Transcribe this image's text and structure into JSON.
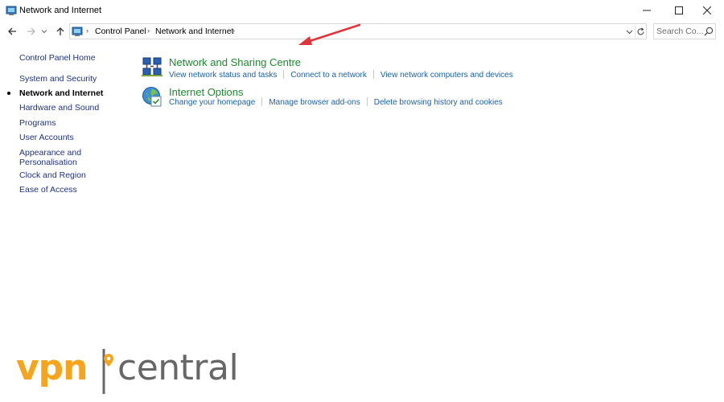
{
  "window": {
    "title": "Network and Internet",
    "icon": "control-panel-icon",
    "controls": {
      "minimize": "minimize-icon",
      "maximize": "maximize-icon",
      "close": "close-icon"
    }
  },
  "navigation": {
    "back_icon": "arrow-left-icon",
    "forward_icon": "arrow-right-icon",
    "recent_icon": "chevron-down-icon",
    "up_icon": "arrow-up-icon",
    "breadcrumb": [
      "Control Panel",
      "Network and Internet"
    ],
    "refresh_icon": "refresh-icon",
    "search": {
      "placeholder": "Search Co...",
      "value": ""
    }
  },
  "sidebar": {
    "items": [
      {
        "label": "Control Panel Home",
        "current": false
      },
      {
        "label": "System and Security",
        "current": false
      },
      {
        "label": "Network and Internet",
        "current": true
      },
      {
        "label": "Hardware and Sound",
        "current": false
      },
      {
        "label": "Programs",
        "current": false
      },
      {
        "label": "User Accounts",
        "current": false
      },
      {
        "label": "Appearance and",
        "label2": "Personalisation",
        "current": false
      },
      {
        "label": "Clock and Region",
        "current": false
      },
      {
        "label": "Ease of Access",
        "current": false
      }
    ]
  },
  "categories": [
    {
      "title": "Network and Sharing Centre",
      "icon": "network-sharing-icon",
      "links": [
        "View network status and tasks",
        "Connect to a network",
        "View network computers and devices"
      ]
    },
    {
      "title": "Internet Options",
      "icon": "internet-options-icon",
      "links": [
        "Change your homepage",
        "Manage browser add-ons",
        "Delete browsing history and cookies"
      ]
    }
  ],
  "annotation": {
    "type": "arrow",
    "color": "#e0353a"
  },
  "watermark": {
    "brand_part1": "vpn",
    "brand_part2": "central",
    "brand_color": "#f7a41d",
    "text_color": "#676767"
  },
  "colors": {
    "link": "#1a62b5",
    "category_title": "#1d8a2e",
    "sidebar_link": "#1e3287"
  }
}
